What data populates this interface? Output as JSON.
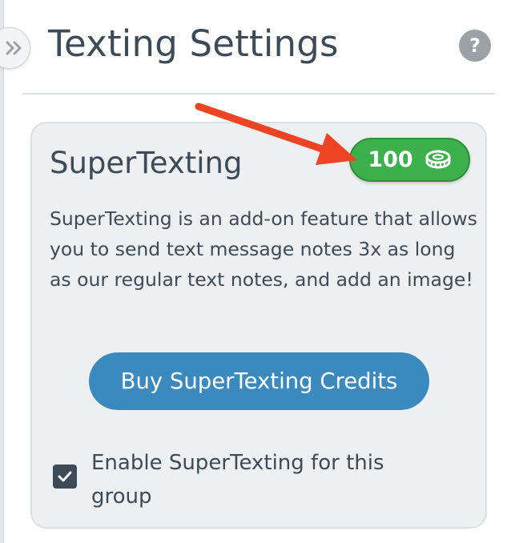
{
  "header": {
    "title": "Texting Settings",
    "collapse_icon": "double-chevron-right-icon",
    "help_label": "?"
  },
  "card": {
    "title": "SuperTexting",
    "credits": "100",
    "credits_icon": "coin-icon",
    "description": "SuperTexting is an add-on feature that allows you to send text message notes 3x as long as our regular text notes, and add an image!",
    "buy_button_label": "Buy SuperTexting Credits",
    "enable_checkbox": {
      "checked": true,
      "label": "Enable SuperTexting for this group"
    }
  },
  "annotation": {
    "icon": "red-arrow-icon",
    "color": "#ee4423"
  },
  "colors": {
    "badge_green": "#3cb04a",
    "button_blue": "#3a8ac0",
    "text_dark": "#3d4a57"
  }
}
